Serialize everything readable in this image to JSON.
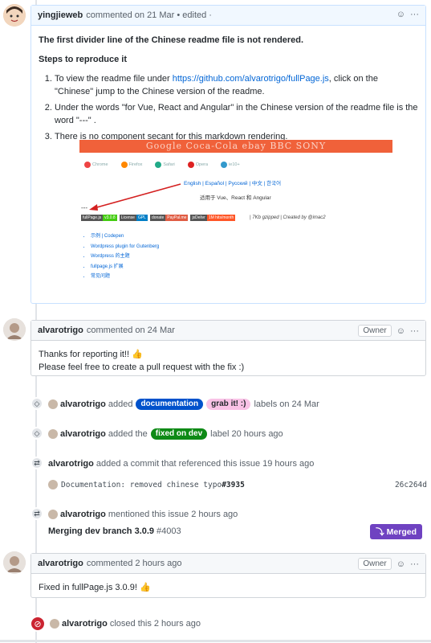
{
  "comment1": {
    "author": "yingjieweb",
    "meta": "commented on 21 Mar • edited ·",
    "title": "The first divider line of the Chinese readme file is not rendered.",
    "steps_heading": "Steps to reproduce it",
    "step1_pre": "To view the readme file under ",
    "step1_link": "https://github.com/alvarotrigo/fullPage.js",
    "step1_post": ", click on the \"Chinese\" jump to the Chinese version of the readme.",
    "step2": "Under the words \"for Vue, React and Angular\" in the Chinese version of the readme file is the word \"---\" .",
    "step3": "There is no component secant for this markdown rendering."
  },
  "embedded_readme": {
    "banner_text": "Google Coca-Cola ebay BBC SONY",
    "browsers": [
      "Chrome",
      "Firefox",
      "Safari",
      "Opera",
      "ie10+"
    ],
    "languages": "English | Español | Русский | 中文 | 한국어",
    "frameworks": "适用于 Vue、React 和 Angular",
    "dashes": "---",
    "shields": [
      {
        "left": "fullPage.js",
        "right": "v3.0.8",
        "color": "#4c1"
      },
      {
        "left": "License",
        "right": "GPL",
        "color": "#007ec6"
      },
      {
        "left": "donate",
        "right": "PayPal.me",
        "color": "#e05d44"
      },
      {
        "left": "jsDelivr",
        "right": "1M hits/month",
        "color": "#ff5627"
      }
    ],
    "size_note": "|  7Kb gzipped  |  Created by @imac2",
    "links": [
      "示例 | Codepen",
      "Wordpress plugin for Gutenberg",
      "Wordpress 的主题",
      "fullpage.js 扩展",
      "常见问题"
    ]
  },
  "comment2": {
    "author": "alvarotrigo",
    "meta": "commented on 24 Mar",
    "role": "Owner",
    "line1": "Thanks for reporting it!! 👍",
    "line2": "Please feel free to create a pull request with the fix :)"
  },
  "event_labels": {
    "author": "alvarotrigo",
    "action": "added",
    "label1": "documentation",
    "label2": "grab it! :)",
    "suffix": "labels on 24 Mar"
  },
  "event_label2": {
    "author": "alvarotrigo",
    "action": "added the",
    "label": "fixed on dev",
    "suffix": "label 20 hours ago"
  },
  "event_commit": {
    "author": "alvarotrigo",
    "text": "added a commit that referenced this issue 19 hours ago",
    "commit_msg": "Documentation: removed chinese typo ",
    "commit_ref": "#3935",
    "sha": "26c264d"
  },
  "event_mention": {
    "author": "alvarotrigo",
    "text": "mentioned this issue 2 hours ago",
    "pr_title": "Merging dev branch 3.0.9",
    "pr_num": "#4003",
    "status": "Merged"
  },
  "comment3": {
    "author": "alvarotrigo",
    "meta": "commented 2 hours ago",
    "role": "Owner",
    "body": "Fixed in fullPage.js 3.0.9! 👍"
  },
  "event_closed": {
    "author": "alvarotrigo",
    "text": "closed this 2 hours ago"
  },
  "colors": {
    "label_documentation": "#0052cc",
    "label_grab": "#f9c2e6",
    "label_fixed": "#0e8a16",
    "merged": "#6f42c1",
    "closed": "#cb2431"
  }
}
